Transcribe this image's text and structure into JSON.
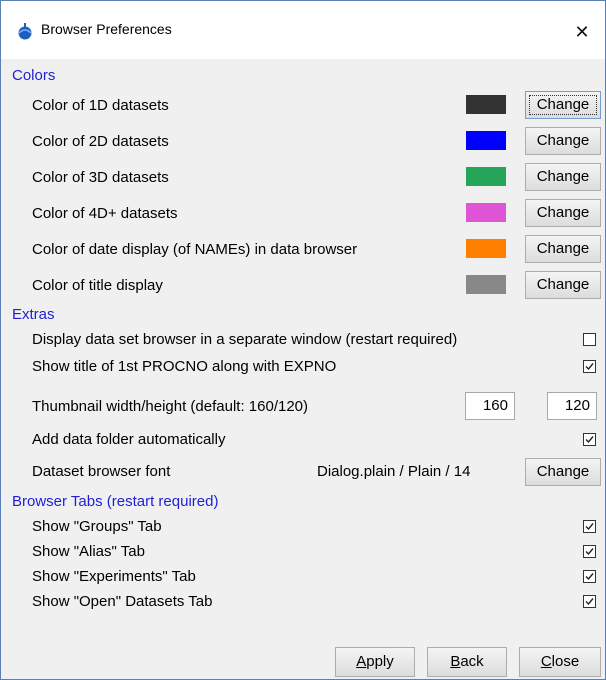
{
  "window": {
    "title": "Browser Preferences",
    "close_glyph": "✕",
    "icon": "app-icon"
  },
  "sections": {
    "colors": "Colors",
    "extras": "Extras",
    "tabs": "Browser Tabs (restart required)"
  },
  "colors": [
    {
      "label": "Color of 1D datasets",
      "swatch": "#333333",
      "button": "Change"
    },
    {
      "label": "Color of 2D datasets",
      "swatch": "#0000ff",
      "button": "Change"
    },
    {
      "label": "Color of 3D datasets",
      "swatch": "#26a65b",
      "button": "Change"
    },
    {
      "label": "Color of 4D+ datasets",
      "swatch": "#e055d8",
      "button": "Change"
    },
    {
      "label": "Color of date display (of NAMEs) in data browser",
      "swatch": "#ff7f00",
      "button": "Change"
    },
    {
      "label": "Color of title display",
      "swatch": "#888888",
      "button": "Change"
    }
  ],
  "extras": {
    "separate_window": {
      "label": "Display data set browser in a separate window (restart required)",
      "checked": false
    },
    "show_title": {
      "label": "Show title of 1st PROCNO along with EXPNO",
      "checked": true
    },
    "thumbnail": {
      "label": "Thumbnail width/height (default: 160/120)",
      "width": "160",
      "height": "120"
    },
    "add_folder": {
      "label": "Add data folder automatically",
      "checked": true
    },
    "font": {
      "label": "Dataset browser font",
      "value": "Dialog.plain / Plain / 14",
      "button": "Change"
    }
  },
  "tabs": [
    {
      "label": "Show \"Groups\" Tab",
      "checked": true
    },
    {
      "label": "Show \"Alias\" Tab",
      "checked": true
    },
    {
      "label": "Show \"Experiments\" Tab",
      "checked": true
    },
    {
      "label": "Show \"Open\" Datasets Tab",
      "checked": true
    }
  ],
  "buttons": {
    "apply": {
      "mnemonic": "A",
      "rest": "pply"
    },
    "back": {
      "mnemonic": "B",
      "rest": "ack"
    },
    "close": {
      "mnemonic": "C",
      "rest": "lose"
    }
  }
}
